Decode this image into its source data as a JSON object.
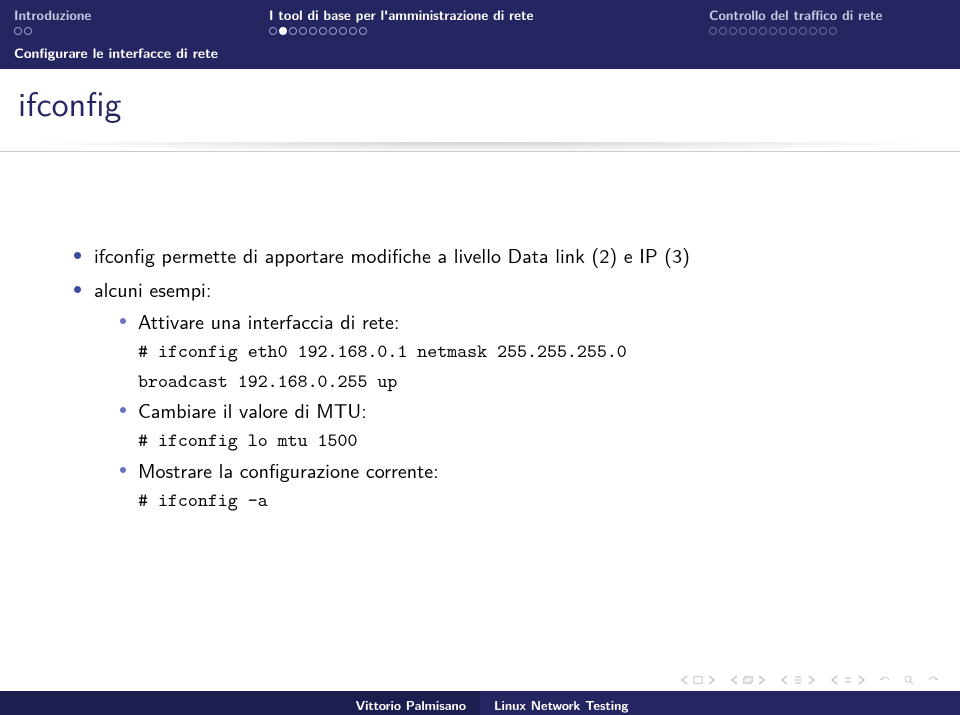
{
  "nav": {
    "sections": [
      {
        "label": "Introduzione",
        "active": false
      },
      {
        "label": "I tool di base per l'amministrazione di rete",
        "active": true
      },
      {
        "label": "Controllo del traffico di rete",
        "active": false
      }
    ],
    "subsection": "Configurare le interfacce di rete"
  },
  "slide": {
    "title": "ifconfig"
  },
  "content": {
    "bullet1": "ifconfig permette di apportare modifiche a livello Data link (2) e IP (3)",
    "bullet2": "alcuni esempi:",
    "ex1_label": "Attivare una interfaccia di rete:",
    "ex1_cmd_line1": "# ifconfig eth0 192.168.0.1 netmask 255.255.255.0",
    "ex1_cmd_line2": "broadcast 192.168.0.255 up",
    "ex2_label": "Cambiare il valore di MTU:",
    "ex2_cmd": "# ifconfig lo mtu 1500",
    "ex3_label": "Mostrare la configurazione corrente:",
    "ex3_cmd": "# ifconfig -a"
  },
  "footer": {
    "author": "Vittorio Palmisano",
    "title": "Linux Network Testing"
  }
}
